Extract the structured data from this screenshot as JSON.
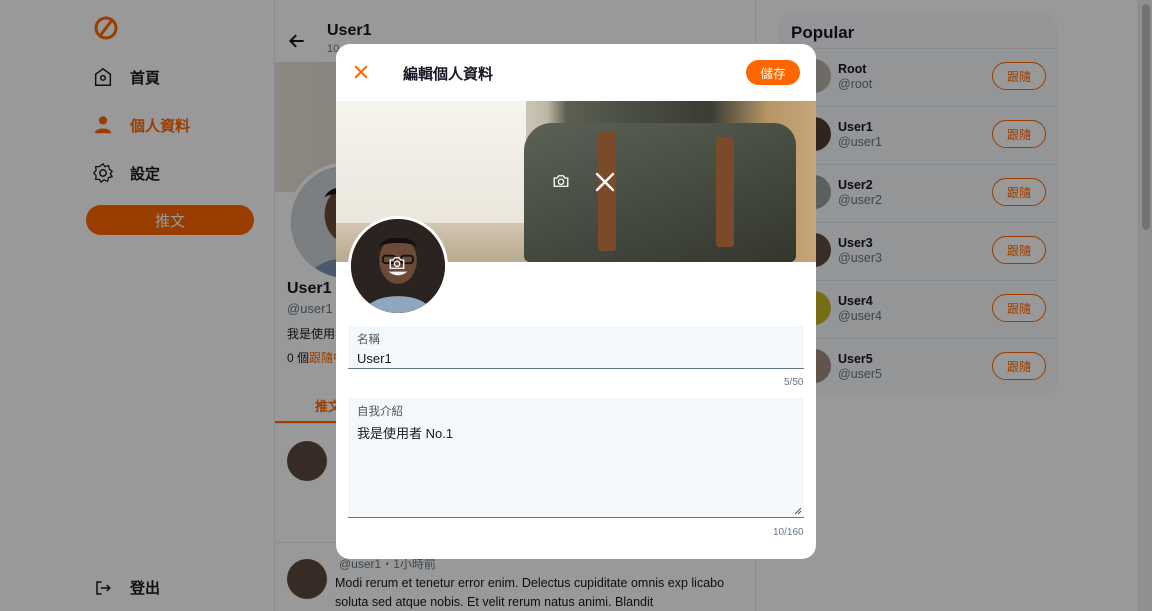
{
  "nav": {
    "items": [
      {
        "label": "首頁",
        "icon": "home-icon"
      },
      {
        "label": "個人資料",
        "icon": "user-icon"
      },
      {
        "label": "設定",
        "icon": "gear-icon"
      }
    ],
    "tweet_button": "推文",
    "logout": "登出"
  },
  "profile": {
    "header_title": "User1",
    "header_sub": "10",
    "name": "User1",
    "handle": "@user1",
    "bio": "我是使用者",
    "follow_count": "0 個",
    "follow_label": "跟隨中",
    "tab_label": "推文"
  },
  "tweets": [
    {
      "meta": "@user1・1小時前",
      "text": "Modi rerum et tenetur error enim. Delectus cupiditate omnis exp licabo soluta sed atque nobis. Et velit rerum natus animi. Blandit"
    }
  ],
  "popular": {
    "title": "Popular",
    "follow_label": "跟隨",
    "users": [
      {
        "name": "Root",
        "handle": "@root"
      },
      {
        "name": "User1",
        "handle": "@user1"
      },
      {
        "name": "User2",
        "handle": "@user2"
      },
      {
        "name": "User3",
        "handle": "@user3"
      },
      {
        "name": "User4",
        "handle": "@user4"
      },
      {
        "name": "User5",
        "handle": "@user5"
      }
    ]
  },
  "modal": {
    "title": "編輯個人資料",
    "save_label": "儲存",
    "name_field": {
      "label": "名稱",
      "value": "User1",
      "count": "5/50"
    },
    "bio_field": {
      "label": "自我介紹",
      "value": "我是使用者 No.1",
      "count": "10/160"
    }
  },
  "colors": {
    "accent": "#ff6600",
    "overlay": "rgba(0,0,0,0.4)"
  }
}
